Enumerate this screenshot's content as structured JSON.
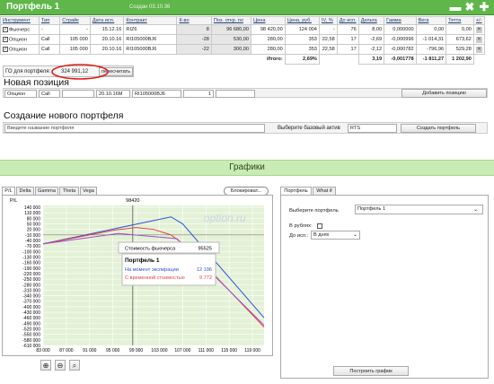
{
  "window": {
    "title": "Портфель 1",
    "created": "Создан 03.10.36",
    "btn_minimize": "▬",
    "btn_close": "✖",
    "btn_add": "✚"
  },
  "table": {
    "headers": [
      "Инструмент",
      "Тип",
      "Страйк",
      "Дата исп.",
      "Контракт",
      "К-во",
      "Поз. откр. по",
      "Цена",
      "Цена, руб.",
      "IV, %",
      "До исп.",
      "Дельта",
      "Гамма",
      "Вега",
      "Тетта",
      "+/-"
    ],
    "rows": [
      [
        "Фьючерс",
        "-",
        "-",
        "15.12.16",
        "RIZ6",
        "8",
        "96 680,00",
        "98 420,00",
        "124 004",
        "-",
        "76",
        "8,00",
        "0,000000",
        "0,00",
        "0,00"
      ],
      [
        "Опцион",
        "Call",
        "105 000",
        "20.10.16",
        "RI105000BJ6",
        "-28",
        "530,00",
        "280,00",
        "353",
        "22,58",
        "17",
        "-2,69",
        "-0,000996",
        "-1 014,31",
        "673,62"
      ],
      [
        "Опцион",
        "Call",
        "105 000",
        "20.10.16",
        "RI105000BJ6",
        "-22",
        "300,00",
        "280,00",
        "353",
        "22,58",
        "17",
        "-2,12",
        "-0,000782",
        "-796,96",
        "529,28"
      ]
    ],
    "total_label": "Итого:",
    "total_pct": "2,69%",
    "totals": [
      "3,19",
      "-0,001778",
      "-1 811,27",
      "1 202,90"
    ]
  },
  "go": {
    "label": "ГО для портфеля:",
    "value": "324 991,12",
    "recalc": "пересчитать"
  },
  "new_position": {
    "title": "Новая позиция",
    "type": "Опцион",
    "opt": "Call",
    "date": "20.10.16M",
    "contract": "RI105000BJ6",
    "qty": "1",
    "add": "Добавить позицию"
  },
  "new_portfolio": {
    "title": "Создание нового портфеля",
    "name_placeholder": "Введите название портфеля",
    "asset_label": "Выберите базовый актив",
    "asset": "RTS",
    "create": "Создать портфель"
  },
  "charts_title": "Графики",
  "tabs": [
    "P/L",
    "Delta",
    "Gamma",
    "Theta",
    "Vega"
  ],
  "block": "Блокироват...",
  "right_tabs": [
    "Портфель",
    "What if"
  ],
  "chart_data": {
    "type": "line",
    "ylabel": "P/L",
    "x_top": "98420",
    "xlim": [
      83000,
      121000
    ],
    "ylim": [
      -610000,
      150000
    ],
    "xticks": [
      "83 000",
      "87 000",
      "91 000",
      "95 000",
      "99 000",
      "103 000",
      "107 000",
      "111 000",
      "115 000",
      "119 000"
    ],
    "yticks": [
      "140 000",
      "110 000",
      "80 000",
      "50 000",
      "20 000",
      "-10 000",
      "-40 000",
      "-70 000",
      "-100 000",
      "-130 000",
      "-160 000",
      "-190 000",
      "-220 000",
      "-250 000",
      "-280 000",
      "-310 000",
      "-340 000",
      "-370 000",
      "-400 000",
      "-430 000",
      "-460 000",
      "-490 000",
      "-520 000",
      "-550 000",
      "-580 000",
      "-610 000"
    ],
    "series": [
      {
        "name": "На момент экспирации",
        "color": "#2e4fd8",
        "x": [
          83000,
          105000,
          107000,
          121000
        ],
        "y": [
          -58000,
          88000,
          50000,
          -460000
        ]
      },
      {
        "name": "С временной стоимостью",
        "color": "#e04040",
        "x": [
          83000,
          95000,
          99000,
          102000,
          105000,
          108000,
          121000
        ],
        "y": [
          -59000,
          15000,
          30000,
          20000,
          -10000,
          -80000,
          -510000
        ]
      }
    ],
    "series_colors": [
      "#2e4fd8",
      "#e04040",
      "#9c4fd6"
    ],
    "tooltip": {
      "future_label": "Стоимость фьючерса",
      "future_value": "95525",
      "title": "Портфель 1",
      "exp_label": "На момент экспирации",
      "exp_value": "12 196",
      "tv_label": "С временной стоимостью",
      "tv_value": "9 772"
    },
    "watermark": "option.ru"
  },
  "right_panel": {
    "portfolio_label": "Выберите портфель",
    "portfolio": "Портфель 1",
    "rubles_label": "В рублях:",
    "until_label": "До исп.:",
    "until": "В днях",
    "build": "Построить график"
  }
}
